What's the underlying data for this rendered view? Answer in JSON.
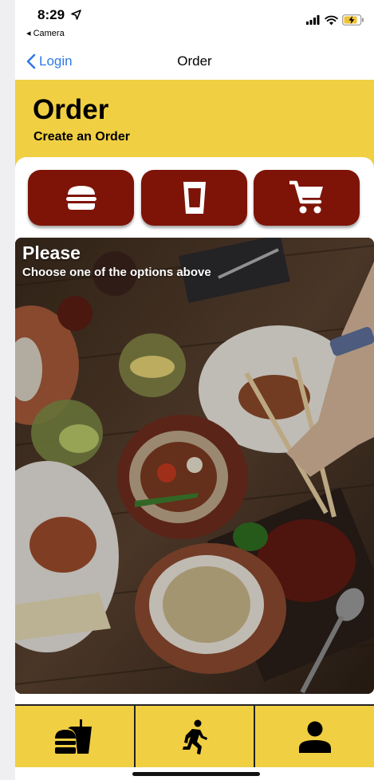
{
  "status_bar": {
    "time": "8:29",
    "back_app": "◂ Camera"
  },
  "nav": {
    "back_label": "Login",
    "title": "Order"
  },
  "header": {
    "title": "Order",
    "subtitle": "Create an Order"
  },
  "hero": {
    "title": "Please",
    "subtitle": "Choose one of the options above"
  },
  "category_buttons": [
    {
      "icon": "burger-icon"
    },
    {
      "icon": "drink-cup-icon"
    },
    {
      "icon": "shopping-cart-icon"
    }
  ],
  "tab_bar": [
    {
      "icon": "fastfood-icon"
    },
    {
      "icon": "running-person-icon"
    },
    {
      "icon": "person-icon"
    }
  ],
  "colors": {
    "brand_yellow": "#f0cf42",
    "button_red": "#7e1408",
    "link_blue": "#2f7ae5"
  }
}
